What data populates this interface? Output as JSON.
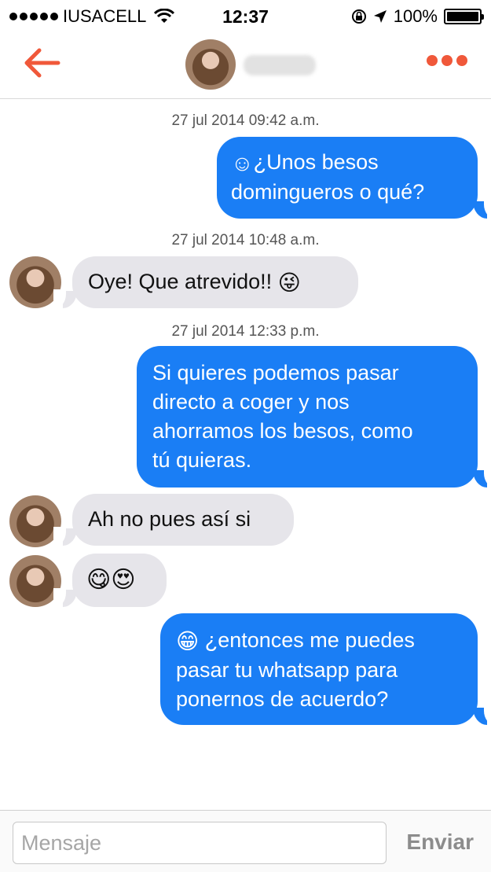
{
  "status_bar": {
    "carrier": "IUSACELL",
    "time": "12:37",
    "battery": "100%",
    "signal_bars": 5,
    "icons": [
      "wifi-icon",
      "lock-rotation-icon",
      "location-arrow-icon",
      "battery-icon"
    ]
  },
  "header": {
    "back_icon": "back-arrow-icon",
    "more_icon": "more-dots-icon",
    "accent_color": "#f0583a"
  },
  "messages": [
    {
      "type": "timestamp",
      "text": "27 jul 2014 09:42 a.m."
    },
    {
      "type": "outgoing",
      "emoji": "☺",
      "text": "¿Unos besos\ndomingueros o qué?"
    },
    {
      "type": "timestamp",
      "text": "27 jul 2014 10:48 a.m."
    },
    {
      "type": "incoming",
      "text": "Oye! Que atrevido!!",
      "emoji": "😜"
    },
    {
      "type": "timestamp",
      "text": "27 jul 2014 12:33 p.m."
    },
    {
      "type": "outgoing",
      "text": "Si quieres podemos pasar\ndirecto a coger y nos\nahorramos los besos, como\ntú quieras."
    },
    {
      "type": "incoming",
      "text": "Ah no pues así si"
    },
    {
      "type": "incoming",
      "emoji": "😋😍"
    },
    {
      "type": "outgoing",
      "emoji": "😁",
      "text": "¿entonces me puedes\npasar tu whatsapp para\nponernos de acuerdo?"
    }
  ],
  "input": {
    "placeholder": "Mensaje",
    "value": "",
    "send_label": "Enviar"
  },
  "colors": {
    "outgoing_bubble": "#1a7ef5",
    "incoming_bubble": "#e6e5ea"
  }
}
